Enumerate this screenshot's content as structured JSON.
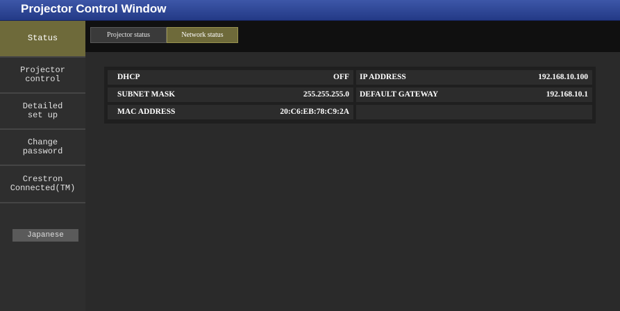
{
  "window": {
    "title": "Projector Control Window"
  },
  "sidebar": {
    "items": [
      {
        "label": "Status"
      },
      {
        "label": "Projector\ncontrol"
      },
      {
        "label": "Detailed\nset up"
      },
      {
        "label": "Change\npassword"
      },
      {
        "label": "Crestron\nConnected(TM)"
      }
    ],
    "language_button": "Japanese"
  },
  "tabs": [
    {
      "label": "Projector status"
    },
    {
      "label": "Network status"
    }
  ],
  "network": {
    "dhcp": {
      "label": "DHCP",
      "value": "OFF"
    },
    "ip_address": {
      "label": "IP ADDRESS",
      "value": "192.168.10.100"
    },
    "subnet_mask": {
      "label": "SUBNET MASK",
      "value": "255.255.255.0"
    },
    "default_gateway": {
      "label": "DEFAULT GATEWAY",
      "value": "192.168.10.1"
    },
    "mac_address": {
      "label": "MAC ADDRESS",
      "value": "20:C6:EB:78:C9:2A"
    }
  },
  "colors": {
    "accent": "#6e6a3a",
    "titlebar": "#2f4a9a",
    "background": "#2a2a2a"
  }
}
